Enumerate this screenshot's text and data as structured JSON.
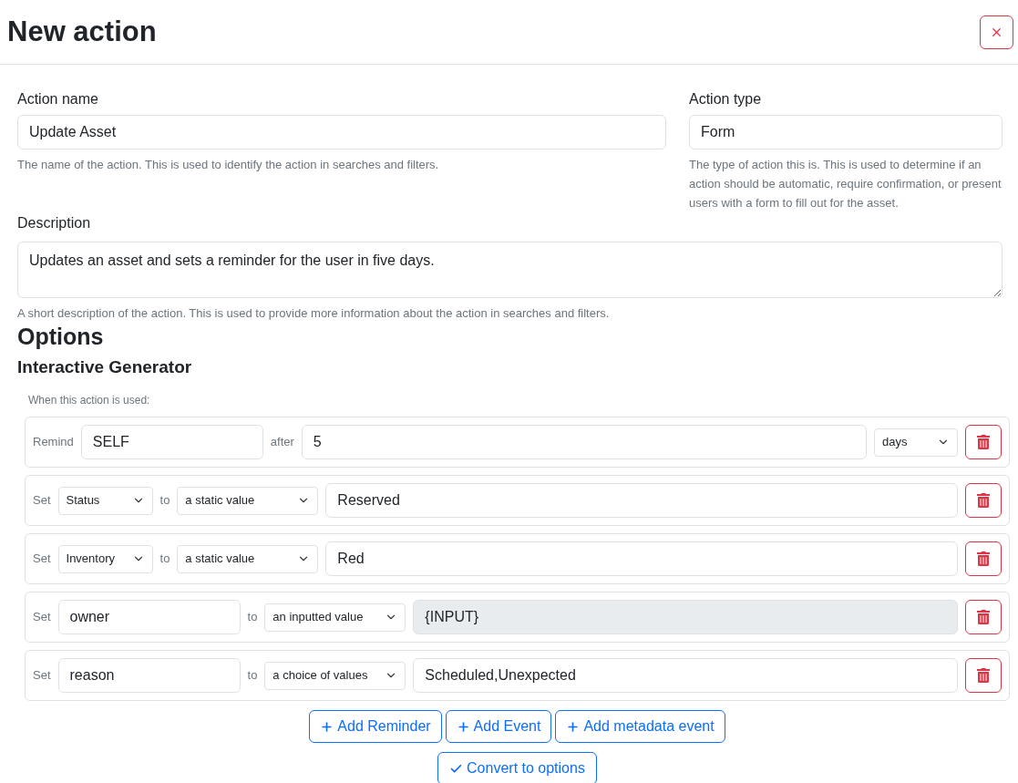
{
  "dialog": {
    "title": "New action"
  },
  "action_name": {
    "label": "Action name",
    "value": "Update Asset",
    "help": "The name of the action. This is used to identify the action in searches and filters."
  },
  "action_type": {
    "label": "Action type",
    "value": "Form",
    "help": "The type of action this is. This is used to determine if an action should be automatic, require confirmation, or present users with a form to fill out for the asset."
  },
  "description": {
    "label": "Description",
    "value": "Updates an asset and sets a reminder for the user in five days.",
    "help": "A short description of the action. This is used to provide more information about the action in searches and filters."
  },
  "options": {
    "heading": "Options",
    "subheading": "Interactive Generator",
    "intro": "When this action is used:",
    "rows": [
      {
        "items": [
          {
            "kind": "label",
            "text": "Remind"
          },
          {
            "kind": "input",
            "value": "SELF",
            "disabled": false
          },
          {
            "kind": "label",
            "text": "after"
          },
          {
            "kind": "input",
            "value": "5",
            "disabled": false
          },
          {
            "kind": "select",
            "value": "days"
          }
        ]
      },
      {
        "items": [
          {
            "kind": "label",
            "text": "Set"
          },
          {
            "kind": "select",
            "value": "Status"
          },
          {
            "kind": "label",
            "text": "to"
          },
          {
            "kind": "select",
            "value": "a static value"
          },
          {
            "kind": "input",
            "value": "Reserved",
            "disabled": false
          }
        ]
      },
      {
        "items": [
          {
            "kind": "label",
            "text": "Set"
          },
          {
            "kind": "select",
            "value": "Inventory"
          },
          {
            "kind": "label",
            "text": "to"
          },
          {
            "kind": "select",
            "value": "a static value"
          },
          {
            "kind": "input",
            "value": "Red",
            "disabled": false
          }
        ]
      },
      {
        "items": [
          {
            "kind": "label",
            "text": "Set"
          },
          {
            "kind": "input",
            "value": "owner",
            "disabled": false
          },
          {
            "kind": "label",
            "text": "to"
          },
          {
            "kind": "select",
            "value": "an inputted value"
          },
          {
            "kind": "input",
            "value": "{INPUT}",
            "disabled": true
          }
        ]
      },
      {
        "items": [
          {
            "kind": "label",
            "text": "Set"
          },
          {
            "kind": "input",
            "value": "reason",
            "disabled": false
          },
          {
            "kind": "label",
            "text": "to"
          },
          {
            "kind": "select",
            "value": "a choice of values"
          },
          {
            "kind": "input",
            "value": "Scheduled,Unexpected",
            "disabled": false
          }
        ]
      }
    ]
  },
  "add_buttons": [
    "Add Reminder",
    "Add Event",
    "Add metadata event"
  ],
  "convert_button": {
    "label": "Convert to options"
  }
}
